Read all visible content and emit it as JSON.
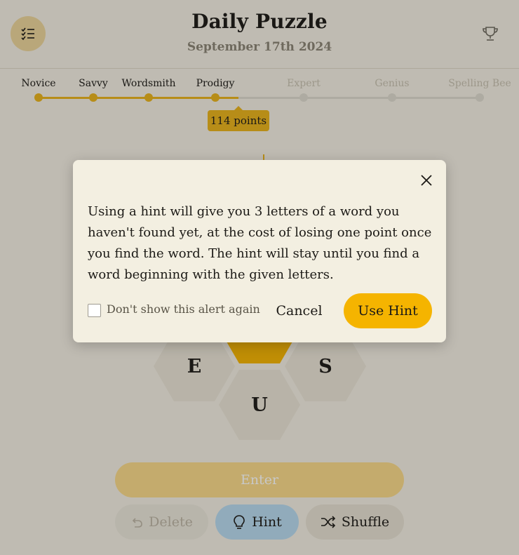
{
  "header": {
    "title": "Daily Puzzle",
    "date": "September 17th 2024",
    "menu_icon": "checklist-icon",
    "trophy_icon": "trophy-icon"
  },
  "progress": {
    "ranks": [
      {
        "label": "Novice",
        "reached": true
      },
      {
        "label": "Savvy",
        "reached": true
      },
      {
        "label": "Wordsmith",
        "reached": true
      },
      {
        "label": "Prodigy",
        "reached": true
      },
      {
        "label": "Expert",
        "reached": false
      },
      {
        "label": "Genius",
        "reached": false
      },
      {
        "label": "Spelling Bee",
        "reached": false
      }
    ],
    "points_label": "114 points"
  },
  "hive": {
    "letters": {
      "left": "E",
      "right": "S",
      "bottom": "U"
    }
  },
  "controls": {
    "enter_label": "Enter",
    "delete_label": "Delete",
    "hint_label": "Hint",
    "shuffle_label": "Shuffle"
  },
  "modal": {
    "message": "Using a hint will give you 3 letters of a word you haven't found yet, at the cost of losing one point once you find the word. The hint will stay until you find a word beginning with the given letters.",
    "checkbox_label": "Don't show this alert again",
    "checkbox_checked": false,
    "cancel_label": "Cancel",
    "confirm_label": "Use Hint"
  },
  "colors": {
    "accent": "#f5b400",
    "progress": "#e9b21a",
    "background": "#f4efe2",
    "hint_button": "#b8d9ef"
  }
}
